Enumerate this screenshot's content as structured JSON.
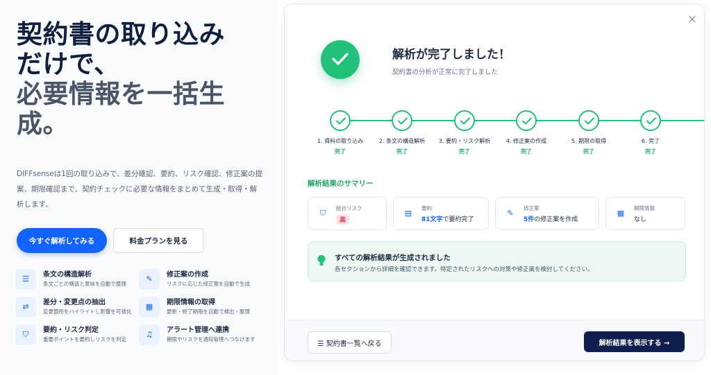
{
  "hero": {
    "title_line1": "契約書の取り込み",
    "title_line2": "だけで、",
    "title_line3": "必要情報を一括生",
    "title_line4": "成。",
    "description": "DIFFsenseは1回の取り込みで、差分確認、要約、リスク確認、修正案の提案、期限確認まで、契約チェックに必要な情報をまとめて生成・取得・解析します。",
    "primary_button": "今すぐ解析してみる",
    "secondary_button": "料金プランを見る"
  },
  "features": [
    {
      "icon": "list-icon",
      "title": "条文の構造解析",
      "desc": "条文ごとの構造と意味を自動で整理"
    },
    {
      "icon": "edit-icon",
      "title": "修正案の作成",
      "desc": "リスクに応じた修正案を自動で生成"
    },
    {
      "icon": "diff-icon",
      "title": "差分・変更点の抽出",
      "desc": "変更箇所をハイライトし影響を可視化"
    },
    {
      "icon": "calendar-icon",
      "title": "期限情報の取得",
      "desc": "更新・終了期限を自動で検出・整理"
    },
    {
      "icon": "shield-icon",
      "title": "要約・リスク判定",
      "desc": "重要ポイントを要約しリスクを判定"
    },
    {
      "icon": "bell-icon",
      "title": "アラート管理へ連携",
      "desc": "期限やリスクを通知管理へつなげます"
    }
  ],
  "modal": {
    "close": "×",
    "title": "解析が完了しました！",
    "subtitle": "契約書の分析が正常に完了しました",
    "steps": [
      {
        "label": "1. 資料の取り込み",
        "status": "完了"
      },
      {
        "label": "2. 条文の構造解析",
        "status": "完了"
      },
      {
        "label": "3. 要約・リスク解析",
        "status": "完了"
      },
      {
        "label": "4. 修正案の作成",
        "status": "完了"
      },
      {
        "label": "5. 期限の取得",
        "status": "完了"
      },
      {
        "label": "6. 完了",
        "status": "完了"
      }
    ],
    "summary_heading": "解析結果のサマリー",
    "summary": {
      "risk": {
        "icon": "shield-icon",
        "label": "総合リスク",
        "value": "高"
      },
      "summary": {
        "icon": "document-icon",
        "label": "要約",
        "value_bold": "81文字",
        "value_rest": "で要約完了"
      },
      "revision": {
        "icon": "edit-icon",
        "label": "修正案",
        "value_bold": "5件",
        "value_rest": "の修正案を作成"
      },
      "deadline": {
        "icon": "calendar-icon",
        "label": "期限情報",
        "value": "なし"
      }
    },
    "notice_title": "すべての解析結果が生成されました",
    "notice_desc": "各セクションから詳細を確認できます。特定されたリスクへの対策や修正案を検討してください。",
    "back_button": "契約書一覧へ戻る",
    "show_button": "解析結果を表示する",
    "show_arrow": "→"
  }
}
